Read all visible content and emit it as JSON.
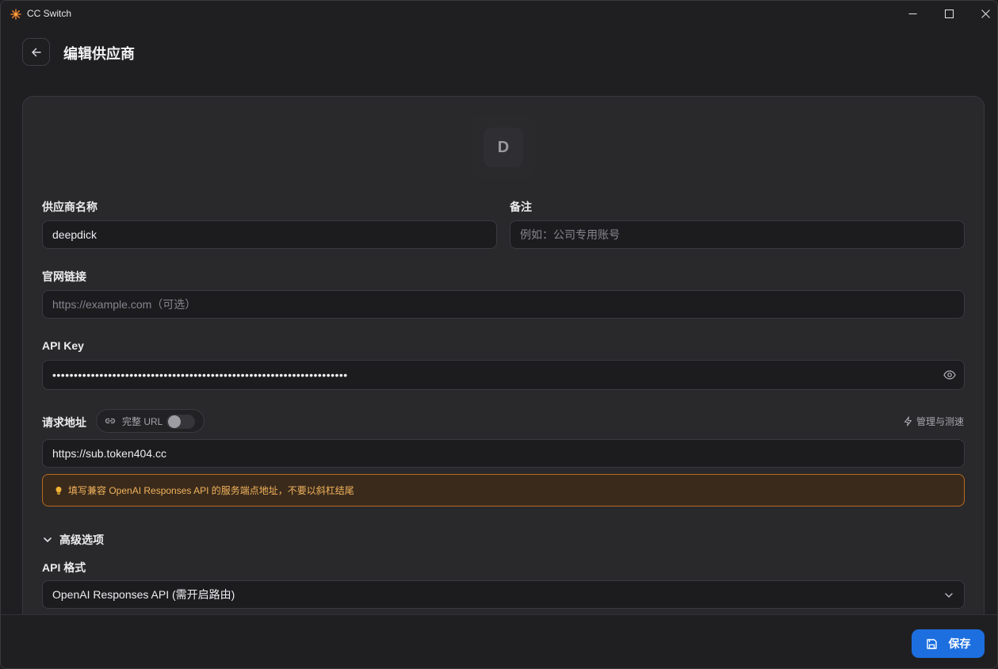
{
  "window": {
    "title": "CC Switch"
  },
  "header": {
    "title": "编辑供应商"
  },
  "avatar": {
    "letter": "D"
  },
  "form": {
    "name_label": "供应商名称",
    "name_value": "deepdick",
    "note_label": "备注",
    "note_placeholder": "例如：公司专用账号",
    "website_label": "官网链接",
    "website_placeholder": "https://example.com（可选）",
    "apikey_label": "API Key",
    "apikey_masked": "•••••••••••••••••••••••••••••••••••••••••••••••••••••••••••••••••••••",
    "endpoint_label": "请求地址",
    "full_url_label": "完整 URL",
    "full_url_enabled": false,
    "manage_label": "管理与测速",
    "endpoint_value": "https://sub.token404.cc",
    "hint": "填写兼容 OpenAI Responses API 的服务端点地址，不要以斜杠结尾",
    "advanced_label": "高级选项",
    "api_format_label": "API 格式",
    "api_format_value": "OpenAI Responses API (需开启路由)"
  },
  "footer": {
    "save_label": "保存"
  },
  "colors": {
    "accent": "#1d6fe0",
    "warning_border": "#b86a1e",
    "warning_text": "#f2b45c"
  }
}
